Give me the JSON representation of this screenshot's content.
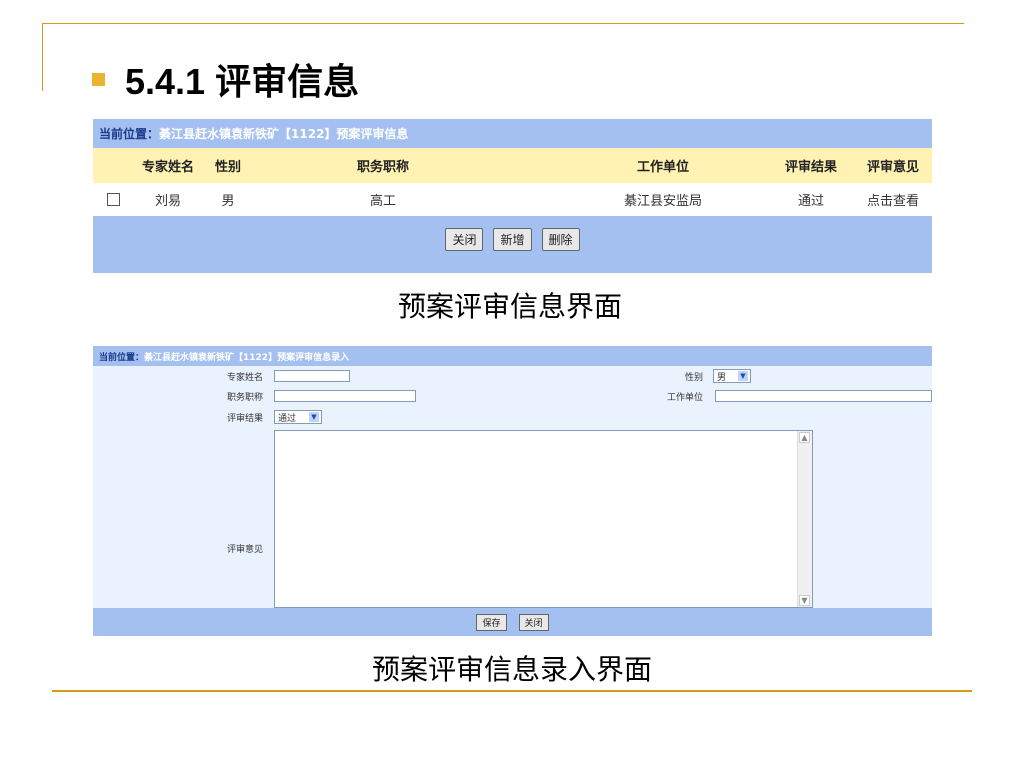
{
  "slide": {
    "title": "5.4.1 评审信息",
    "accent_color": "#d49a1c",
    "bullet_color": "#e9b531"
  },
  "list_screen": {
    "breadcrumb_label": "当前位置：",
    "breadcrumb_path": "綦江县赶水镇袁新铁矿【1122】预案评审信息",
    "columns": [
      "专家姓名",
      "性别",
      "职务职称",
      "工作单位",
      "评审结果",
      "评审意见"
    ],
    "rows": [
      {
        "name": "刘易",
        "sex": "男",
        "title": "高工",
        "unit": "綦江县安监局",
        "result": "通过",
        "opinion": "点击查看"
      }
    ],
    "buttons": {
      "close": "关闭",
      "add": "新增",
      "delete": "删除"
    },
    "caption": "预案评审信息界面"
  },
  "entry_screen": {
    "breadcrumb_label": "当前位置：",
    "breadcrumb_path": "綦江县赶水镇袁新铁矿【1122】预案评审信息录入",
    "labels": {
      "expert_name": "专家姓名",
      "sex": "性别",
      "job_title": "职务职称",
      "work_unit": "工作单位",
      "result": "评审结果",
      "opinion": "评审意见"
    },
    "values": {
      "expert_name": "",
      "sex": "男",
      "job_title": "",
      "work_unit": "",
      "result": "通过",
      "opinion": ""
    },
    "buttons": {
      "save": "保存",
      "close": "关闭"
    },
    "caption": "预案评审信息录入界面"
  },
  "colors": {
    "header_bar": "#a4c0f0",
    "table_header": "#fff2b3",
    "form_bg": "#e9f2fd"
  }
}
